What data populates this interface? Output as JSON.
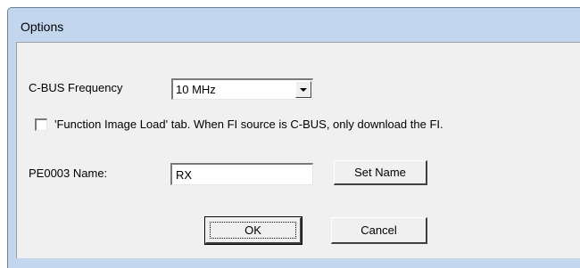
{
  "window": {
    "title": "Options"
  },
  "frequency": {
    "label": "C-BUS Frequency",
    "selected": "10 MHz"
  },
  "fi_option": {
    "checked": false,
    "label": "'Function Image Load' tab. When FI source is C-BUS, only download the FI."
  },
  "name_row": {
    "label": "PE0003 Name:",
    "value": "RX",
    "set_name_label": "Set Name"
  },
  "buttons": {
    "ok_label": "OK",
    "cancel_label": "Cancel"
  },
  "icons": {
    "combo_arrow": "dropdown-arrow-icon"
  }
}
